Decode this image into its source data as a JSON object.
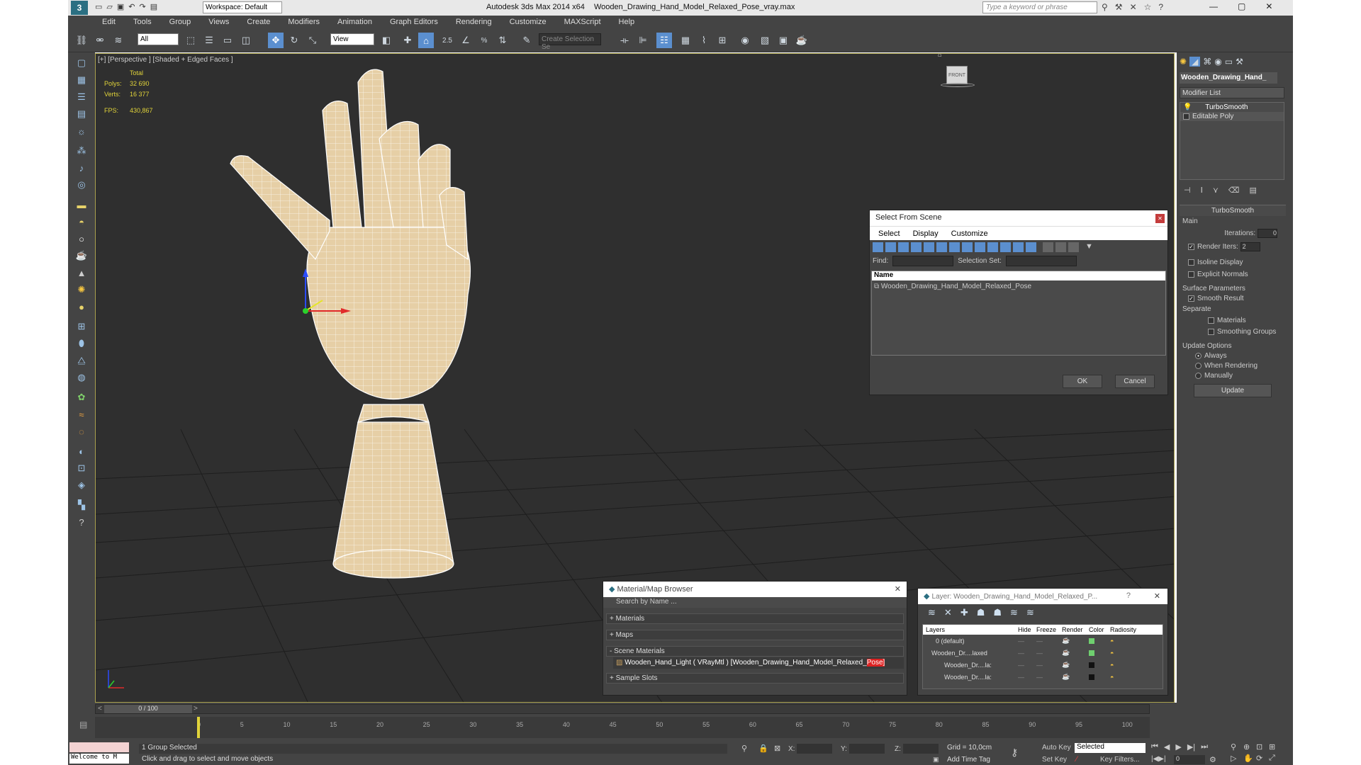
{
  "app": {
    "title_app": "Autodesk 3ds Max  2014 x64",
    "title_file": "Wooden_Drawing_Hand_Model_Relaxed_Pose_vray.max",
    "workspace": "Workspace: Default",
    "search_placeholder": "Type a keyword or phrase"
  },
  "menu": [
    "Edit",
    "Tools",
    "Group",
    "Views",
    "Create",
    "Modifiers",
    "Animation",
    "Graph Editors",
    "Rendering",
    "Customize",
    "MAXScript",
    "Help"
  ],
  "toolbar": {
    "filter": "All",
    "ref_coord": "View",
    "snap_label": "2.5",
    "named_sel_placeholder": "Create Selection Se"
  },
  "viewport": {
    "label": "[+] [Perspective ] [Shaded + Edged Faces ]",
    "stats": {
      "total": "Total",
      "polys_label": "Polys:",
      "polys": "32 690",
      "verts_label": "Verts:",
      "verts": "16 377",
      "fps_label": "FPS:",
      "fps": "430,867"
    },
    "viewcube": "FRONT"
  },
  "cmdpanel": {
    "object_name": "Wooden_Drawing_Hand_",
    "modifier_list": "Modifier List",
    "stack": [
      "TurboSmooth",
      "Editable Poly"
    ],
    "rollout_title": "TurboSmooth",
    "main": "Main",
    "iterations_label": "Iterations:",
    "iterations": "0",
    "render_iters_label": "Render Iters:",
    "render_iters": "2",
    "isoline": "Isoline Display",
    "explicit": "Explicit Normals",
    "surface_params": "Surface Parameters",
    "smooth_result": "Smooth Result",
    "separate": "Separate",
    "materials": "Materials",
    "smoothing_groups": "Smoothing Groups",
    "update_options": "Update Options",
    "always": "Always",
    "when_rendering": "When Rendering",
    "manually": "Manually",
    "update_btn": "Update"
  },
  "select_dialog": {
    "title": "Select From Scene",
    "menu": [
      "Select",
      "Display",
      "Customize"
    ],
    "find_label": "Find:",
    "selection_set_label": "Selection Set:",
    "col_name": "Name",
    "items": [
      "Wooden_Drawing_Hand_Model_Relaxed_Pose"
    ],
    "ok": "OK",
    "cancel": "Cancel"
  },
  "material_browser": {
    "title": "Material/Map Browser",
    "search_placeholder": "Search by Name ...",
    "groups": [
      "+ Materials",
      "+ Maps",
      "- Scene Materials",
      "+ Sample Slots"
    ],
    "material_entry_a": "Wooden_Hand_Light ( VRayMtl ) [Wooden_Drawing_Hand_Model_Relaxed_",
    "material_entry_b": "Pose",
    "material_entry_c": "]"
  },
  "layer_dialog": {
    "title": "Layer: Wooden_Drawing_Hand_Model_Relaxed_P...",
    "help": "?",
    "columns": [
      "Layers",
      "Hide",
      "Freeze",
      "Render",
      "Color",
      "Radiosity"
    ],
    "rows": [
      {
        "name": "0 (default)",
        "color": "#6fcf6f"
      },
      {
        "name": "Wooden_Dr....laxed",
        "color": "#6fcf6f"
      },
      {
        "name": "Wooden_Dr....la:",
        "color": "#111111"
      },
      {
        "name": "Wooden_Dr....la:",
        "color": "#111111"
      }
    ]
  },
  "timeline": {
    "frame": "0 / 100",
    "ticks": [
      "0",
      "5",
      "10",
      "15",
      "20",
      "25",
      "30",
      "35",
      "40",
      "45",
      "50",
      "55",
      "60",
      "65",
      "70",
      "75",
      "80",
      "85",
      "90",
      "95",
      "100"
    ]
  },
  "status": {
    "maxscript": "Welcome to M",
    "selected": "1 Group Selected",
    "prompt": "Click and drag to select and move objects",
    "x_label": "X:",
    "y_label": "Y:",
    "z_label": "Z:",
    "grid": "Grid = 10,0cm",
    "add_time_tag": "Add Time Tag",
    "auto_key": "Auto Key",
    "set_key": "Set Key",
    "selected_combo": "Selected",
    "key_filters": "Key Filters...",
    "frame_field": "0"
  }
}
